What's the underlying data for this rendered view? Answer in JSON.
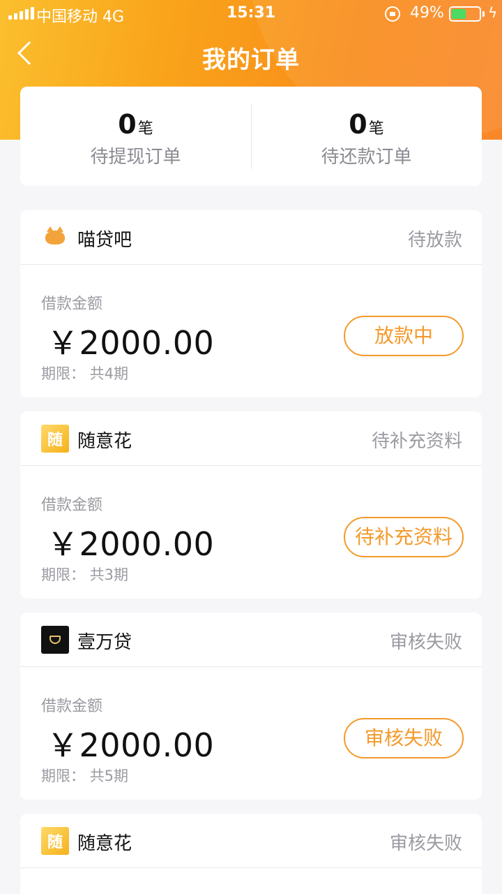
{
  "status_bar": {
    "carrier": "中国移动   4G",
    "time": "15:31",
    "battery": "49%"
  },
  "nav": {
    "title": "我的订单"
  },
  "summary": [
    {
      "count": "0",
      "unit": "笔",
      "label": "待提现订单"
    },
    {
      "count": "0",
      "unit": "笔",
      "label": "待还款订单"
    }
  ],
  "orders": [
    {
      "logo": "miao-logo",
      "logo_text": "喵贷吧",
      "brand": "喵贷吧",
      "status": "待放款",
      "amount_label": "借款金额",
      "amount": "￥2000.00",
      "term": "期限：  共4期",
      "action": "放款中"
    },
    {
      "logo": "suiyi-logo",
      "logo_text": "随",
      "brand": "随意花",
      "status": "待补充资料",
      "amount_label": "借款金额",
      "amount": "￥2000.00",
      "term": "期限：  共3期",
      "action": "待补充资料"
    },
    {
      "logo": "yiwan-logo",
      "logo_text": "壹万贷",
      "brand": "壹万贷",
      "status": "审核失败",
      "amount_label": "借款金额",
      "amount": "￥2000.00",
      "term": "期限：  共5期",
      "action": "审核失败"
    },
    {
      "logo": "suiyi-logo",
      "logo_text": "随",
      "brand": "随意花",
      "status": "审核失败"
    }
  ],
  "colors": {
    "accent": "#f39a2b",
    "header_start": "#fbbf2e",
    "header_end": "#f9882a"
  }
}
